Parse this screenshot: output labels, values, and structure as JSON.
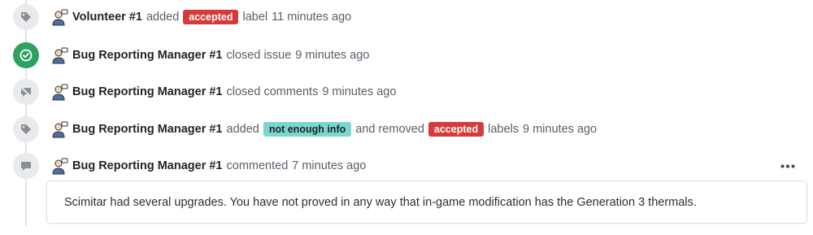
{
  "events": [
    {
      "icon": "tag-icon",
      "actor": "Volunteer #1",
      "verb": "added",
      "label": "accepted",
      "suffix": "label",
      "time": "11 minutes ago"
    },
    {
      "icon": "check-circle-icon",
      "actor": "Bug Reporting Manager #1",
      "verb": "closed issue",
      "time": "9 minutes ago"
    },
    {
      "icon": "comment-closed-icon",
      "actor": "Bug Reporting Manager #1",
      "verb": "closed comments",
      "time": "9 minutes ago"
    },
    {
      "icon": "tag-icon",
      "actor": "Bug Reporting Manager #1",
      "verb": "added",
      "added_label": "not enough info",
      "middle": "and removed",
      "removed_label": "accepted",
      "suffix": "labels",
      "time": "9 minutes ago"
    },
    {
      "icon": "comment-icon",
      "actor": "Bug Reporting Manager #1",
      "verb": "commented",
      "time": "7 minutes ago",
      "more_icon": "ellipsis-icon",
      "comment": "Scimitar had several upgrades. You have not proved in any way that in-game modification has the Generation 3 thermals."
    }
  ],
  "colors": {
    "accepted": "#d73a3a",
    "not_enough_info": "#7bd6cf",
    "closed_badge": "#2ea05f",
    "icon_badge": "#e9eaec"
  }
}
